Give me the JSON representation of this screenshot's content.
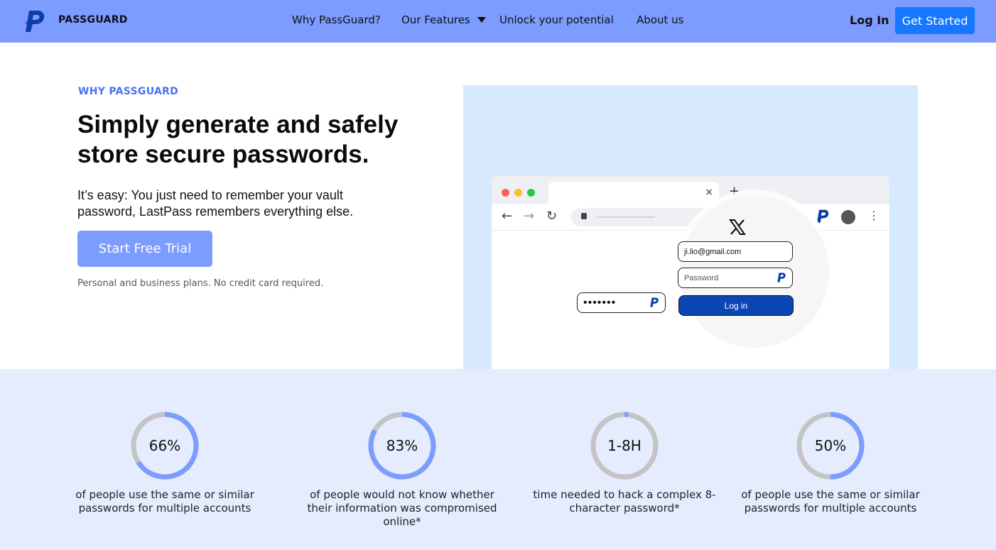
{
  "header": {
    "brand": "PASSGUARD",
    "nav": {
      "why": "Why PassGuard?",
      "features": "Our Features",
      "unlock": "Unlock your potential",
      "about": "About us"
    },
    "login_label": "Log In",
    "cta_label": "Get Started"
  },
  "hero": {
    "eyebrow": "WHY PASSGUARD",
    "headline": "Simply generate and safely store secure passwords.",
    "lead": "It’s easy: You just need to remember your vault password, LastPass remembers everything else.",
    "trial_label": "Start Free Trial",
    "note": "Personal and business plans. No credit card required."
  },
  "illustration": {
    "tab_close": "×",
    "new_tab": "+",
    "email_value": "ji.lio@gmail.com",
    "password_placeholder": "Password",
    "login_button": "Log in",
    "masked_password": "•••••••"
  },
  "stats": [
    {
      "value": "66%",
      "fraction": 0.66,
      "text": "of people use the same or similar passwords for multiple accounts"
    },
    {
      "value": "83%",
      "fraction": 0.83,
      "text": "of people would not know whether their information was compromised online*"
    },
    {
      "value": "1-8H",
      "fraction": 0.02,
      "text": "time needed to hack a complex 8-character password*"
    },
    {
      "value": "50%",
      "fraction": 0.5,
      "text": "of people use the same or similar passwords for multiple accounts"
    }
  ],
  "colors": {
    "header_bg": "#7d9cff",
    "accent": "#1677ff",
    "ring_fill": "#7d9cff",
    "ring_track": "#c4c4c4",
    "stats_bg": "#e4ecfd"
  }
}
